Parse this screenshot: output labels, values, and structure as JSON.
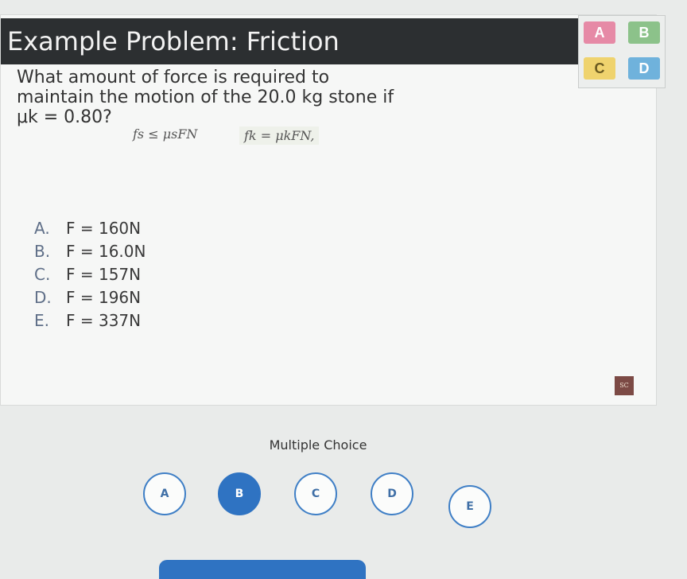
{
  "slide": {
    "title": "Example Problem:  Friction",
    "question_lines": [
      "What amount of force is required to",
      "maintain the motion of the 20.0 kg stone if",
      "μk = 0.80?"
    ],
    "formula_static": "fs ≤ μsFN",
    "formula_kinetic": "fk = μkFN,",
    "options": [
      {
        "letter": "A.",
        "text": "F = 160N"
      },
      {
        "letter": "B.",
        "text": "F = 16.0N"
      },
      {
        "letter": "C.",
        "text": "F = 157N"
      },
      {
        "letter": "D.",
        "text": "F = 196N"
      },
      {
        "letter": "E.",
        "text": "F = 337N"
      }
    ],
    "logo_tiles": [
      "A",
      "B",
      "C",
      "D"
    ],
    "badge": "SC"
  },
  "answer_panel": {
    "label": "Multiple Choice",
    "choices": [
      "A",
      "B",
      "C",
      "D",
      "E"
    ],
    "selected": "B"
  },
  "colors": {
    "accent": "#2f73c2",
    "title_bg": "#2c2f31",
    "tile_a": "#e68aa6",
    "tile_b": "#8cc28a",
    "tile_c": "#efd36e",
    "tile_d": "#6fb2dc"
  }
}
